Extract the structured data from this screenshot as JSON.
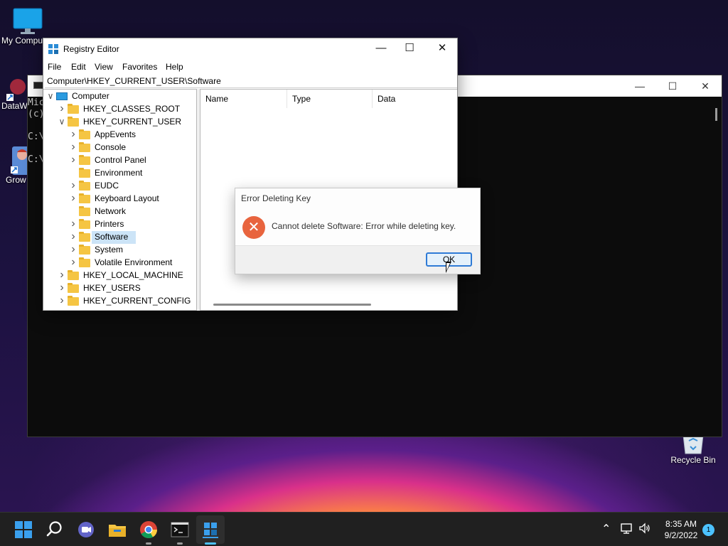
{
  "desktop": {
    "icons": [
      {
        "label": "My Compu"
      },
      {
        "label": "DataW"
      },
      {
        "label": "Grow"
      },
      {
        "label": "Recycle Bin"
      }
    ]
  },
  "cmd": {
    "lines": [
      "Mic",
      "(c)",
      "C:\\",
      "C:\\"
    ]
  },
  "regedit": {
    "title": "Registry Editor",
    "menu": [
      "File",
      "Edit",
      "View",
      "Favorites",
      "Help"
    ],
    "address": "Computer\\HKEY_CURRENT_USER\\Software",
    "tree": [
      {
        "label": "Computer",
        "level": 0,
        "expanded": true
      },
      {
        "label": "HKEY_CLASSES_ROOT",
        "level": 1,
        "expanded": false
      },
      {
        "label": "HKEY_CURRENT_USER",
        "level": 1,
        "expanded": true
      },
      {
        "label": "AppEvents",
        "level": 2,
        "expanded": false
      },
      {
        "label": "Console",
        "level": 2,
        "expanded": false
      },
      {
        "label": "Control Panel",
        "level": 2,
        "expanded": false
      },
      {
        "label": "Environment",
        "level": 2,
        "leaf": true
      },
      {
        "label": "EUDC",
        "level": 2,
        "expanded": false
      },
      {
        "label": "Keyboard Layout",
        "level": 2,
        "expanded": false
      },
      {
        "label": "Network",
        "level": 2,
        "leaf": true
      },
      {
        "label": "Printers",
        "level": 2,
        "expanded": false
      },
      {
        "label": "Software",
        "level": 2,
        "expanded": false,
        "selected": true
      },
      {
        "label": "System",
        "level": 2,
        "expanded": false
      },
      {
        "label": "Volatile Environment",
        "level": 2,
        "expanded": false
      },
      {
        "label": "HKEY_LOCAL_MACHINE",
        "level": 1,
        "expanded": false
      },
      {
        "label": "HKEY_USERS",
        "level": 1,
        "expanded": false
      },
      {
        "label": "HKEY_CURRENT_CONFIG",
        "level": 1,
        "expanded": false
      }
    ],
    "columns": [
      "Name",
      "Type",
      "Data"
    ]
  },
  "dialog": {
    "title": "Error Deleting Key",
    "message": "Cannot delete Software:  Error while deleting key.",
    "ok_label": "OK"
  },
  "taskbar": {
    "time": "8:35 AM",
    "date": "9/2/2022",
    "notification_count": "1",
    "accent_color": "#4cc2ff"
  }
}
